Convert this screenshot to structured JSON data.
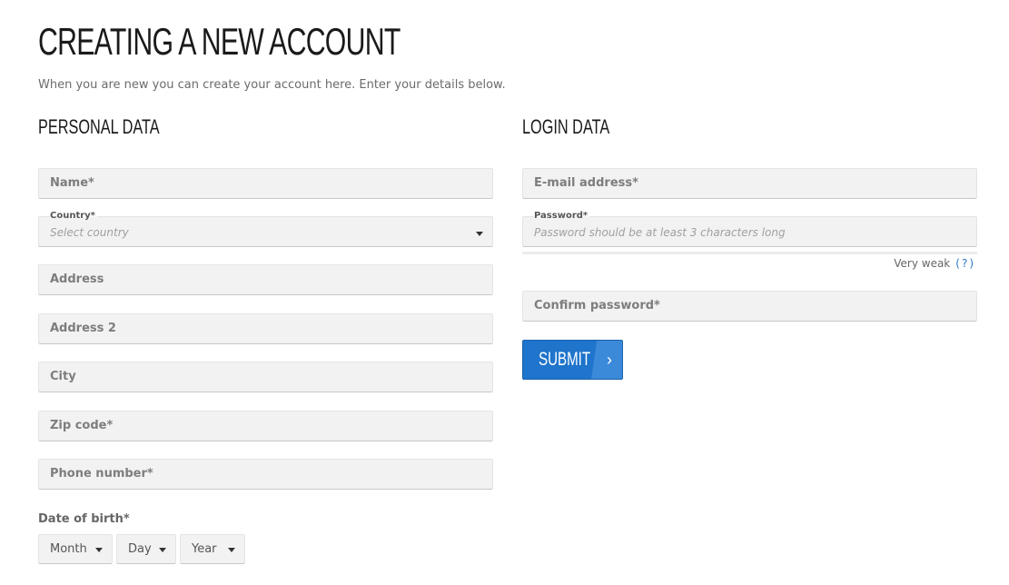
{
  "header": {
    "title": "CREATING A NEW ACCOUNT",
    "intro": "When you are new you can create your account here. Enter your details below."
  },
  "personal": {
    "title": "PERSONAL DATA",
    "name_placeholder": "Name*",
    "country_label": "Country*",
    "country_value": "Select country",
    "address_placeholder": "Address",
    "address2_placeholder": "Address 2",
    "city_placeholder": "City",
    "zip_placeholder": "Zip code*",
    "phone_placeholder": "Phone number*",
    "dob_label": "Date of birth*",
    "dob_month": "Month",
    "dob_day": "Day",
    "dob_year": "Year"
  },
  "login": {
    "title": "LOGIN DATA",
    "email_placeholder": "E-mail address*",
    "password_label": "Password*",
    "password_hint": "Password should be at least 3 characters long",
    "strength_text": "Very weak",
    "strength_help": "(?)",
    "confirm_placeholder": "Confirm password*",
    "submit_label": "SUBMIT",
    "submit_arrow": "›"
  },
  "icons": {
    "dropdown": "chevron-down-icon",
    "submit_arrow": "chevron-right-icon"
  },
  "colors": {
    "accent": "#1f74cc",
    "field_bg": "#f2f2f2",
    "help_link": "#2a77c9"
  }
}
